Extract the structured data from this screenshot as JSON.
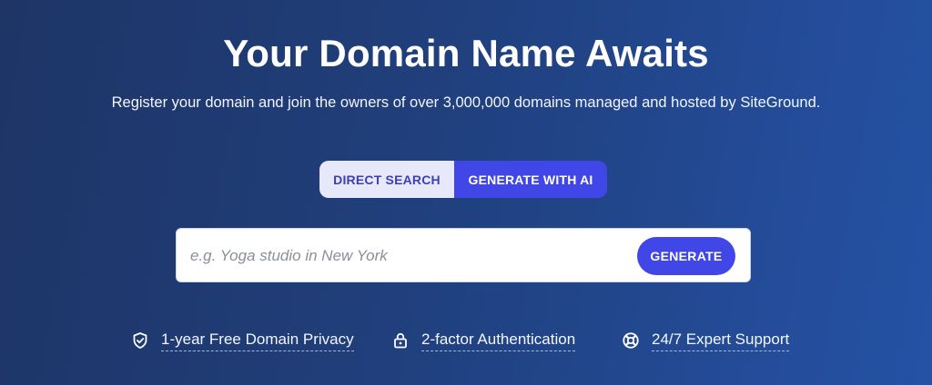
{
  "hero": {
    "title": "Your Domain Name Awaits",
    "subtitle": "Register your domain and join the owners of over 3,000,000 domains managed and hosted by SiteGround."
  },
  "mode_toggle": {
    "tabs": [
      {
        "label": "DIRECT SEARCH",
        "active": false
      },
      {
        "label": "GENERATE WITH AI",
        "active": true
      }
    ]
  },
  "search": {
    "placeholder": "e.g. Yoga studio in New York",
    "value": "",
    "button_label": "GENERATE"
  },
  "features": [
    {
      "icon": "shield-check-icon",
      "label": "1-year Free Domain Privacy"
    },
    {
      "icon": "lock-icon",
      "label": "2-factor Authentication"
    },
    {
      "icon": "lifebuoy-icon",
      "label": "24/7 Expert Support"
    }
  ],
  "colors": {
    "background_start": "#1e3566",
    "background_end": "#2552a6",
    "accent": "#4147e6",
    "tab_inactive_bg": "#e8e8fb",
    "tab_inactive_text": "#3d3fb7"
  }
}
